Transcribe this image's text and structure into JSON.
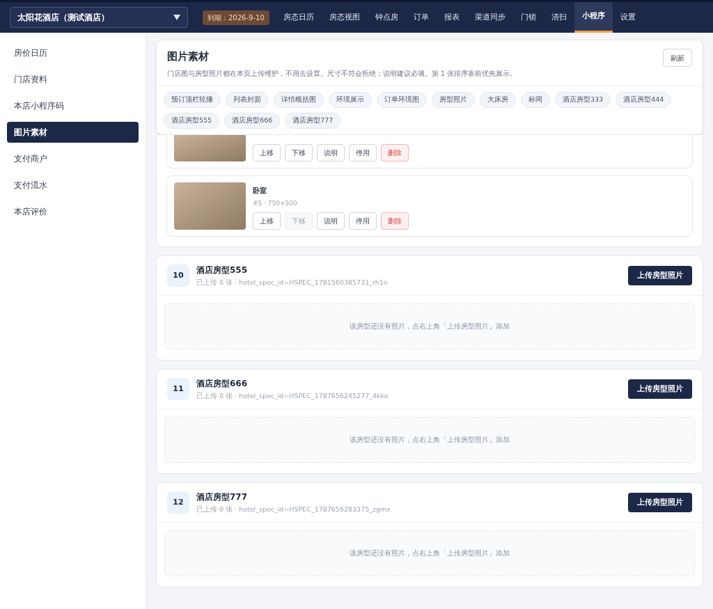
{
  "topbar": {
    "store_selector": "太阳花酒店（测试酒店）",
    "expiry": "到期：2026-9-10",
    "nav": [
      {
        "label": "房态日历",
        "selected": false
      },
      {
        "label": "房态视图",
        "selected": false
      },
      {
        "label": "钟点房",
        "selected": false
      },
      {
        "label": "订单",
        "selected": false
      },
      {
        "label": "报表",
        "selected": false
      },
      {
        "label": "渠道同步",
        "selected": false
      },
      {
        "label": "门锁",
        "selected": false
      },
      {
        "label": "清扫",
        "selected": false
      },
      {
        "label": "小程序",
        "selected": true
      },
      {
        "label": "设置",
        "selected": false
      }
    ]
  },
  "sidebar": {
    "items": [
      {
        "label": "房价日历",
        "selected": false
      },
      {
        "label": "门店资料",
        "selected": false
      },
      {
        "label": "本店小程序码",
        "selected": false
      },
      {
        "label": "图片素材",
        "selected": true
      },
      {
        "label": "支付商户",
        "selected": false
      },
      {
        "label": "支付流水",
        "selected": false
      },
      {
        "label": "本店评价",
        "selected": false
      }
    ]
  },
  "header": {
    "title": "图片素材",
    "description": "门店图与房型照片都在本页上传维护，不用去设置。尺寸不符会拒绝；说明建议必填。第 1 张排序靠前优先展示。",
    "refresh": "刷新",
    "chips": [
      "预订顶栏轮播",
      "列表封面",
      "详情概括图",
      "环境展示",
      "订单环境图",
      "房型照片",
      "大床房",
      "标间",
      "酒店房型333",
      "酒店房型444",
      "酒店房型555",
      "酒店房型666",
      "酒店房型777"
    ]
  },
  "photo_items": [
    {
      "buttons": [
        {
          "label": "上移",
          "kind": "normal",
          "disabled": false
        },
        {
          "label": "下移",
          "kind": "normal",
          "disabled": false
        },
        {
          "label": "说明",
          "kind": "normal",
          "disabled": false
        },
        {
          "label": "停用",
          "kind": "normal",
          "disabled": false
        },
        {
          "label": "删除",
          "kind": "danger",
          "disabled": false
        }
      ]
    },
    {
      "title": "卧室",
      "meta": "#5 · 750×500",
      "buttons": [
        {
          "label": "上移",
          "kind": "normal",
          "disabled": false
        },
        {
          "label": "下移",
          "kind": "normal",
          "disabled": true
        },
        {
          "label": "说明",
          "kind": "normal",
          "disabled": false
        },
        {
          "label": "停用",
          "kind": "normal",
          "disabled": false
        },
        {
          "label": "删除",
          "kind": "danger",
          "disabled": false
        }
      ]
    }
  ],
  "room_types": [
    {
      "index": "10",
      "name": "酒店房型555",
      "meta": "已上传 0 张 · hotel_spec_id=HSPEC_1781560385731_rh1n",
      "upload": "上传房型照片",
      "empty": "该房型还没有照片，点右上角「上传房型照片」添加"
    },
    {
      "index": "11",
      "name": "酒店房型666",
      "meta": "已上传 0 张 · hotel_spec_id=HSPEC_1787656245277_4kko",
      "upload": "上传房型照片",
      "empty": "该房型还没有照片，点右上角「上传房型照片」添加"
    },
    {
      "index": "12",
      "name": "酒店房型777",
      "meta": "已上传 0 张 · hotel_spec_id=HSPEC_1787656283375_zgmx",
      "upload": "上传房型照片",
      "empty": "该房型还没有照片，点右上角「上传房型照片」添加"
    }
  ]
}
